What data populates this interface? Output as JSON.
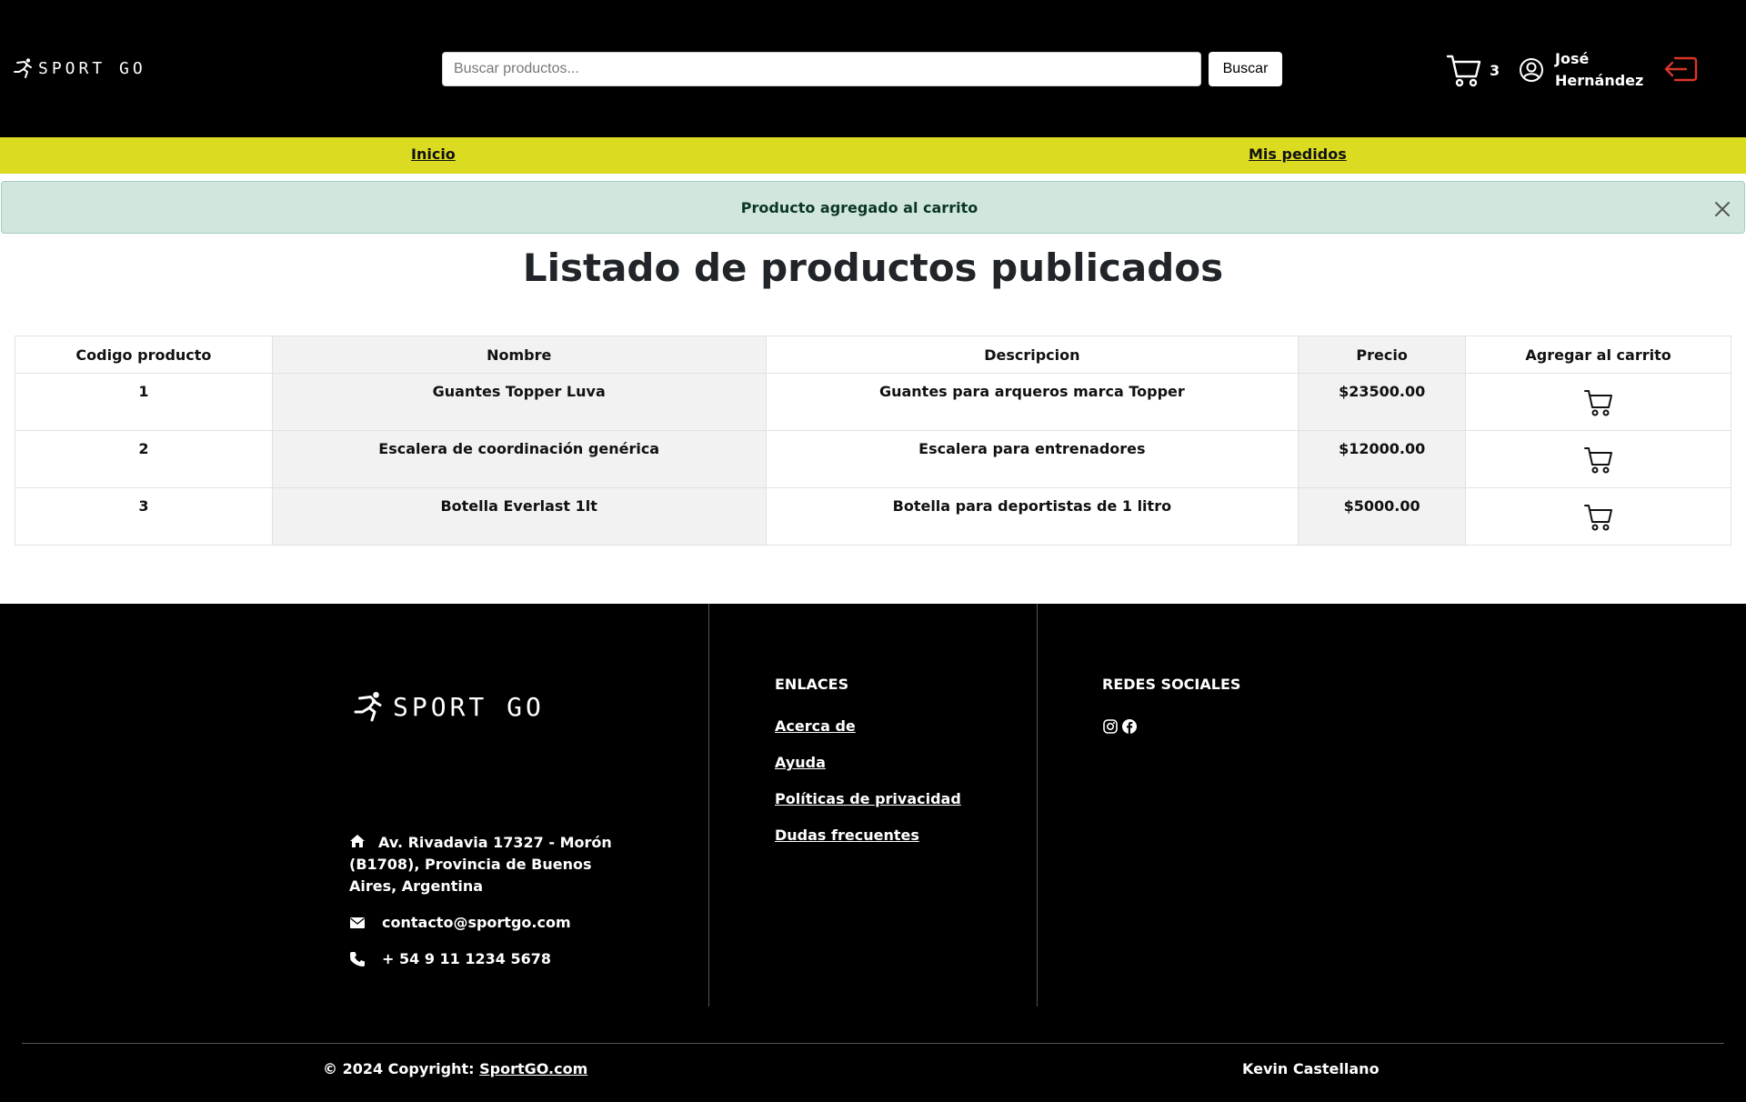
{
  "header": {
    "logo_text": "SPORT GO",
    "search_placeholder": "Buscar productos...",
    "search_button": "Buscar",
    "cart_count": "3",
    "user_name": "José Hernández",
    "logout_color": "#d9352a"
  },
  "nav": {
    "inicio": "Inicio",
    "mis_pedidos": "Mis pedidos"
  },
  "alert": {
    "message": "Producto agregado al carrito"
  },
  "page_title": "Listado de productos publicados",
  "table": {
    "headers": [
      "Codigo producto",
      "Nombre",
      "Descripcion",
      "Precio",
      "Agregar al carrito"
    ],
    "rows": [
      {
        "code": "1",
        "name": "Guantes Topper Luva",
        "description": "Guantes para arqueros marca Topper",
        "price": "$23500.00"
      },
      {
        "code": "2",
        "name": "Escalera de coordinación genérica",
        "description": "Escalera para entrenadores",
        "price": "$12000.00"
      },
      {
        "code": "3",
        "name": "Botella Everlast 1lt",
        "description": "Botella para deportistas de 1 litro",
        "price": "$5000.00"
      }
    ]
  },
  "footer": {
    "logo_text": "SPORT GO",
    "address": "Av. Rivadavia 17327 - Morón (B1708), Provincia de Buenos Aires, Argentina",
    "email": "contacto@sportgo.com",
    "phone": "+ 54 9 11 1234 5678",
    "links_title": "ENLACES",
    "links": [
      "Acerca de",
      "Ayuda",
      "Políticas de privacidad",
      "Dudas frecuentes"
    ],
    "social_title": "REDES SOCIALES",
    "copyright_prefix": "© 2024 Copyright: ",
    "copyright_link": "SportGO.com",
    "author": "Kevin Castellano"
  },
  "colors": {
    "nav_bg": "#dbdb22",
    "alert_bg": "#d1e7dd",
    "header_bg": "#000000"
  }
}
